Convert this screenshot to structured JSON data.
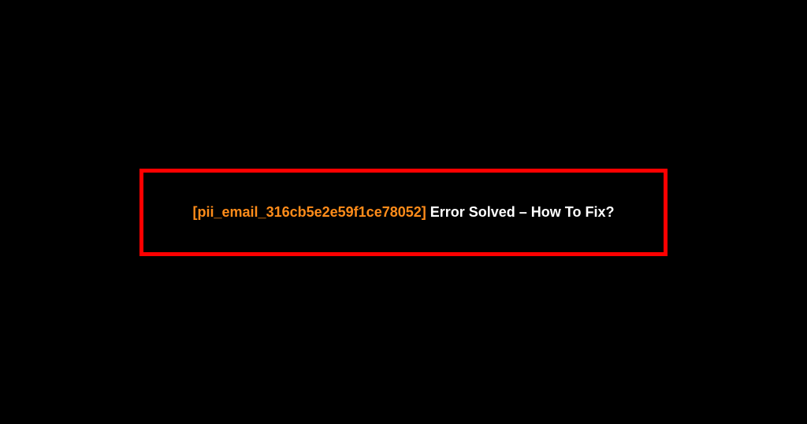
{
  "message": {
    "error_code": "[pii_email_316cb5e2e59f1ce78052]",
    "suffix": " Error Solved – How To Fix?"
  },
  "colors": {
    "background": "#000000",
    "border": "#ff0000",
    "error_code": "#ff8c1a",
    "suffix_text": "#ffffff"
  }
}
